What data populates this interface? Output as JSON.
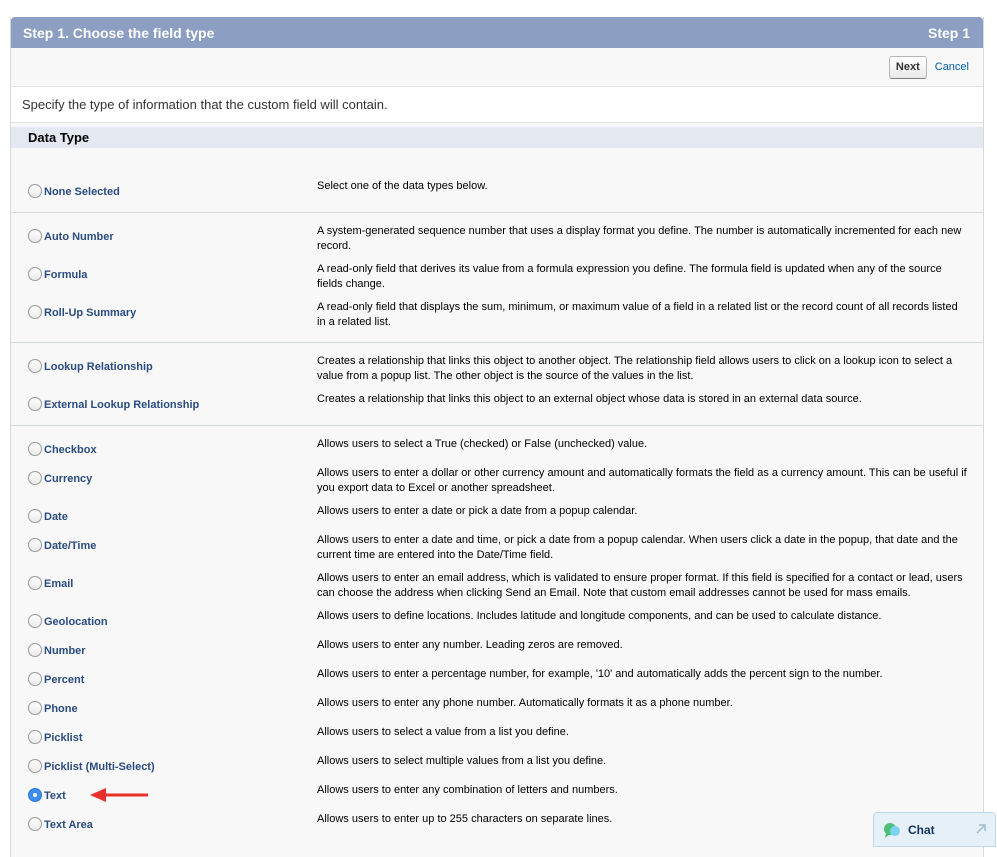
{
  "step": {
    "title": "Step 1. Choose the field type",
    "indicator": "Step 1"
  },
  "buttons": {
    "next": "Next",
    "cancel": "Cancel"
  },
  "instructions": "Specify the type of information that the custom field will contain.",
  "section_title": "Data Type",
  "data_types": [
    {
      "label": "None Selected",
      "description": "Select one of the data types below.",
      "selected": false
    },
    {
      "label": "Auto Number",
      "description": "A system-generated sequence number that uses a display format you define. The number is automatically incremented for each new record.",
      "selected": false
    },
    {
      "label": "Formula",
      "description": "A read-only field that derives its value from a formula expression you define. The formula field is updated when any of the source fields change.",
      "selected": false
    },
    {
      "label": "Roll-Up Summary",
      "description": "A read-only field that displays the sum, minimum, or maximum value of a field in a related list or the record count of all records listed in a related list.",
      "selected": false
    },
    {
      "label": "Lookup Relationship",
      "description": "Creates a relationship that links this object to another object. The relationship field allows users to click on a lookup icon to select a value from a popup list. The other object is the source of the values in the list.",
      "selected": false
    },
    {
      "label": "External Lookup Relationship",
      "description": "Creates a relationship that links this object to an external object whose data is stored in an external data source.",
      "selected": false
    },
    {
      "label": "Checkbox",
      "description": "Allows users to select a True (checked) or False (unchecked) value.",
      "selected": false
    },
    {
      "label": "Currency",
      "description": "Allows users to enter a dollar or other currency amount and automatically formats the field as a currency amount. This can be useful if you export data to Excel or another spreadsheet.",
      "selected": false
    },
    {
      "label": "Date",
      "description": "Allows users to enter a date or pick a date from a popup calendar.",
      "selected": false
    },
    {
      "label": "Date/Time",
      "description": "Allows users to enter a date and time, or pick a date from a popup calendar. When users click a date in the popup, that date and the current time are entered into the Date/Time field.",
      "selected": false
    },
    {
      "label": "Email",
      "description": "Allows users to enter an email address, which is validated to ensure proper format. If this field is specified for a contact or lead, users can choose the address when clicking Send an Email. Note that custom email addresses cannot be used for mass emails.",
      "selected": false
    },
    {
      "label": "Geolocation",
      "description": "Allows users to define locations. Includes latitude and longitude components, and can be used to calculate distance.",
      "selected": false
    },
    {
      "label": "Number",
      "description": "Allows users to enter any number. Leading zeros are removed.",
      "selected": false
    },
    {
      "label": "Percent",
      "description": "Allows users to enter a percentage number, for example, '10' and automatically adds the percent sign to the number.",
      "selected": false
    },
    {
      "label": "Phone",
      "description": "Allows users to enter any phone number. Automatically formats it as a phone number.",
      "selected": false
    },
    {
      "label": "Picklist",
      "description": "Allows users to select a value from a list you define.",
      "selected": false
    },
    {
      "label": "Picklist (Multi-Select)",
      "description": "Allows users to select multiple values from a list you define.",
      "selected": false
    },
    {
      "label": "Text",
      "description": "Allows users to enter any combination of letters and numbers.",
      "selected": true
    },
    {
      "label": "Text Area",
      "description": "Allows users to enter up to 255 characters on separate lines.",
      "selected": false
    }
  ],
  "chat": {
    "label": "Chat",
    "icon": "chat-bubble-icon"
  },
  "colors": {
    "header": "#8c9fc2",
    "section": "#e4e8f1",
    "label": "#2a4c81",
    "link": "#015ba7",
    "selected_radio": "#3b8ff0",
    "arrow": "#e8312a"
  }
}
